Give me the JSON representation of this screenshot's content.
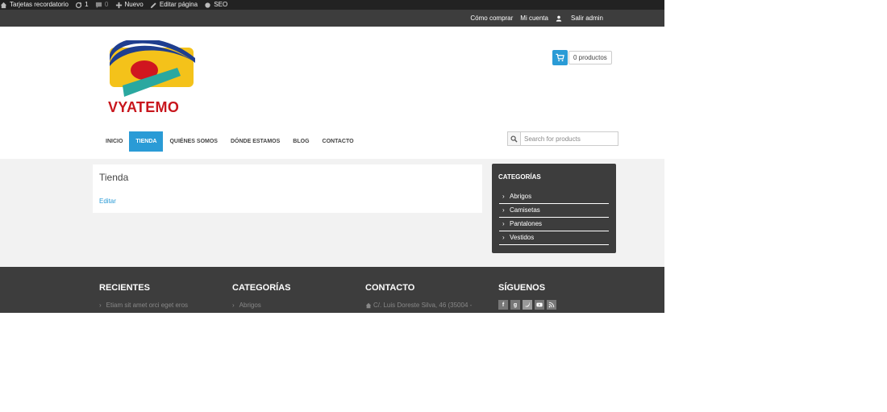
{
  "admin_bar": {
    "site_name": "Tarjetas recordatorio",
    "updates_count": "1",
    "comments_count": "0",
    "new_label": "Nuevo",
    "edit_label": "Editar página",
    "seo_label": "SEO"
  },
  "top_links": {
    "how_to_buy": "Cómo comprar",
    "my_account": "Mi cuenta",
    "logout": "Salir admin"
  },
  "logo": {
    "text": "VYATEMO"
  },
  "cart": {
    "count_label": "0 productos"
  },
  "main_nav": [
    {
      "label": "INICIO"
    },
    {
      "label": "TIENDA"
    },
    {
      "label": "QUIÉNES SOMOS"
    },
    {
      "label": "DÓNDE ESTAMOS"
    },
    {
      "label": "BLOG"
    },
    {
      "label": "CONTACTO"
    }
  ],
  "search": {
    "placeholder": "Search for products"
  },
  "page": {
    "title": "Tienda",
    "edit_link": "Editar"
  },
  "sidebar": {
    "title": "CATEGORÍAS",
    "items": [
      {
        "label": "Abrigos"
      },
      {
        "label": "Camisetas"
      },
      {
        "label": "Pantalones"
      },
      {
        "label": "Vestidos"
      }
    ]
  },
  "footer": {
    "recent": {
      "title": "RECIENTES",
      "first_item": "Etiam sit amet orci eget eros"
    },
    "categories": {
      "title": "CATEGORÍAS",
      "first_item": "Abrigos"
    },
    "contact": {
      "title": "CONTACTO",
      "address": "C/. Luis Doreste Silva, 46 (35004 -"
    },
    "follow": {
      "title": "SÍGUENOS"
    }
  },
  "colors": {
    "accent": "#2a9bd6",
    "dark": "#3d3d3d",
    "admin_bar": "#222222",
    "logo_red": "#c8161d"
  }
}
